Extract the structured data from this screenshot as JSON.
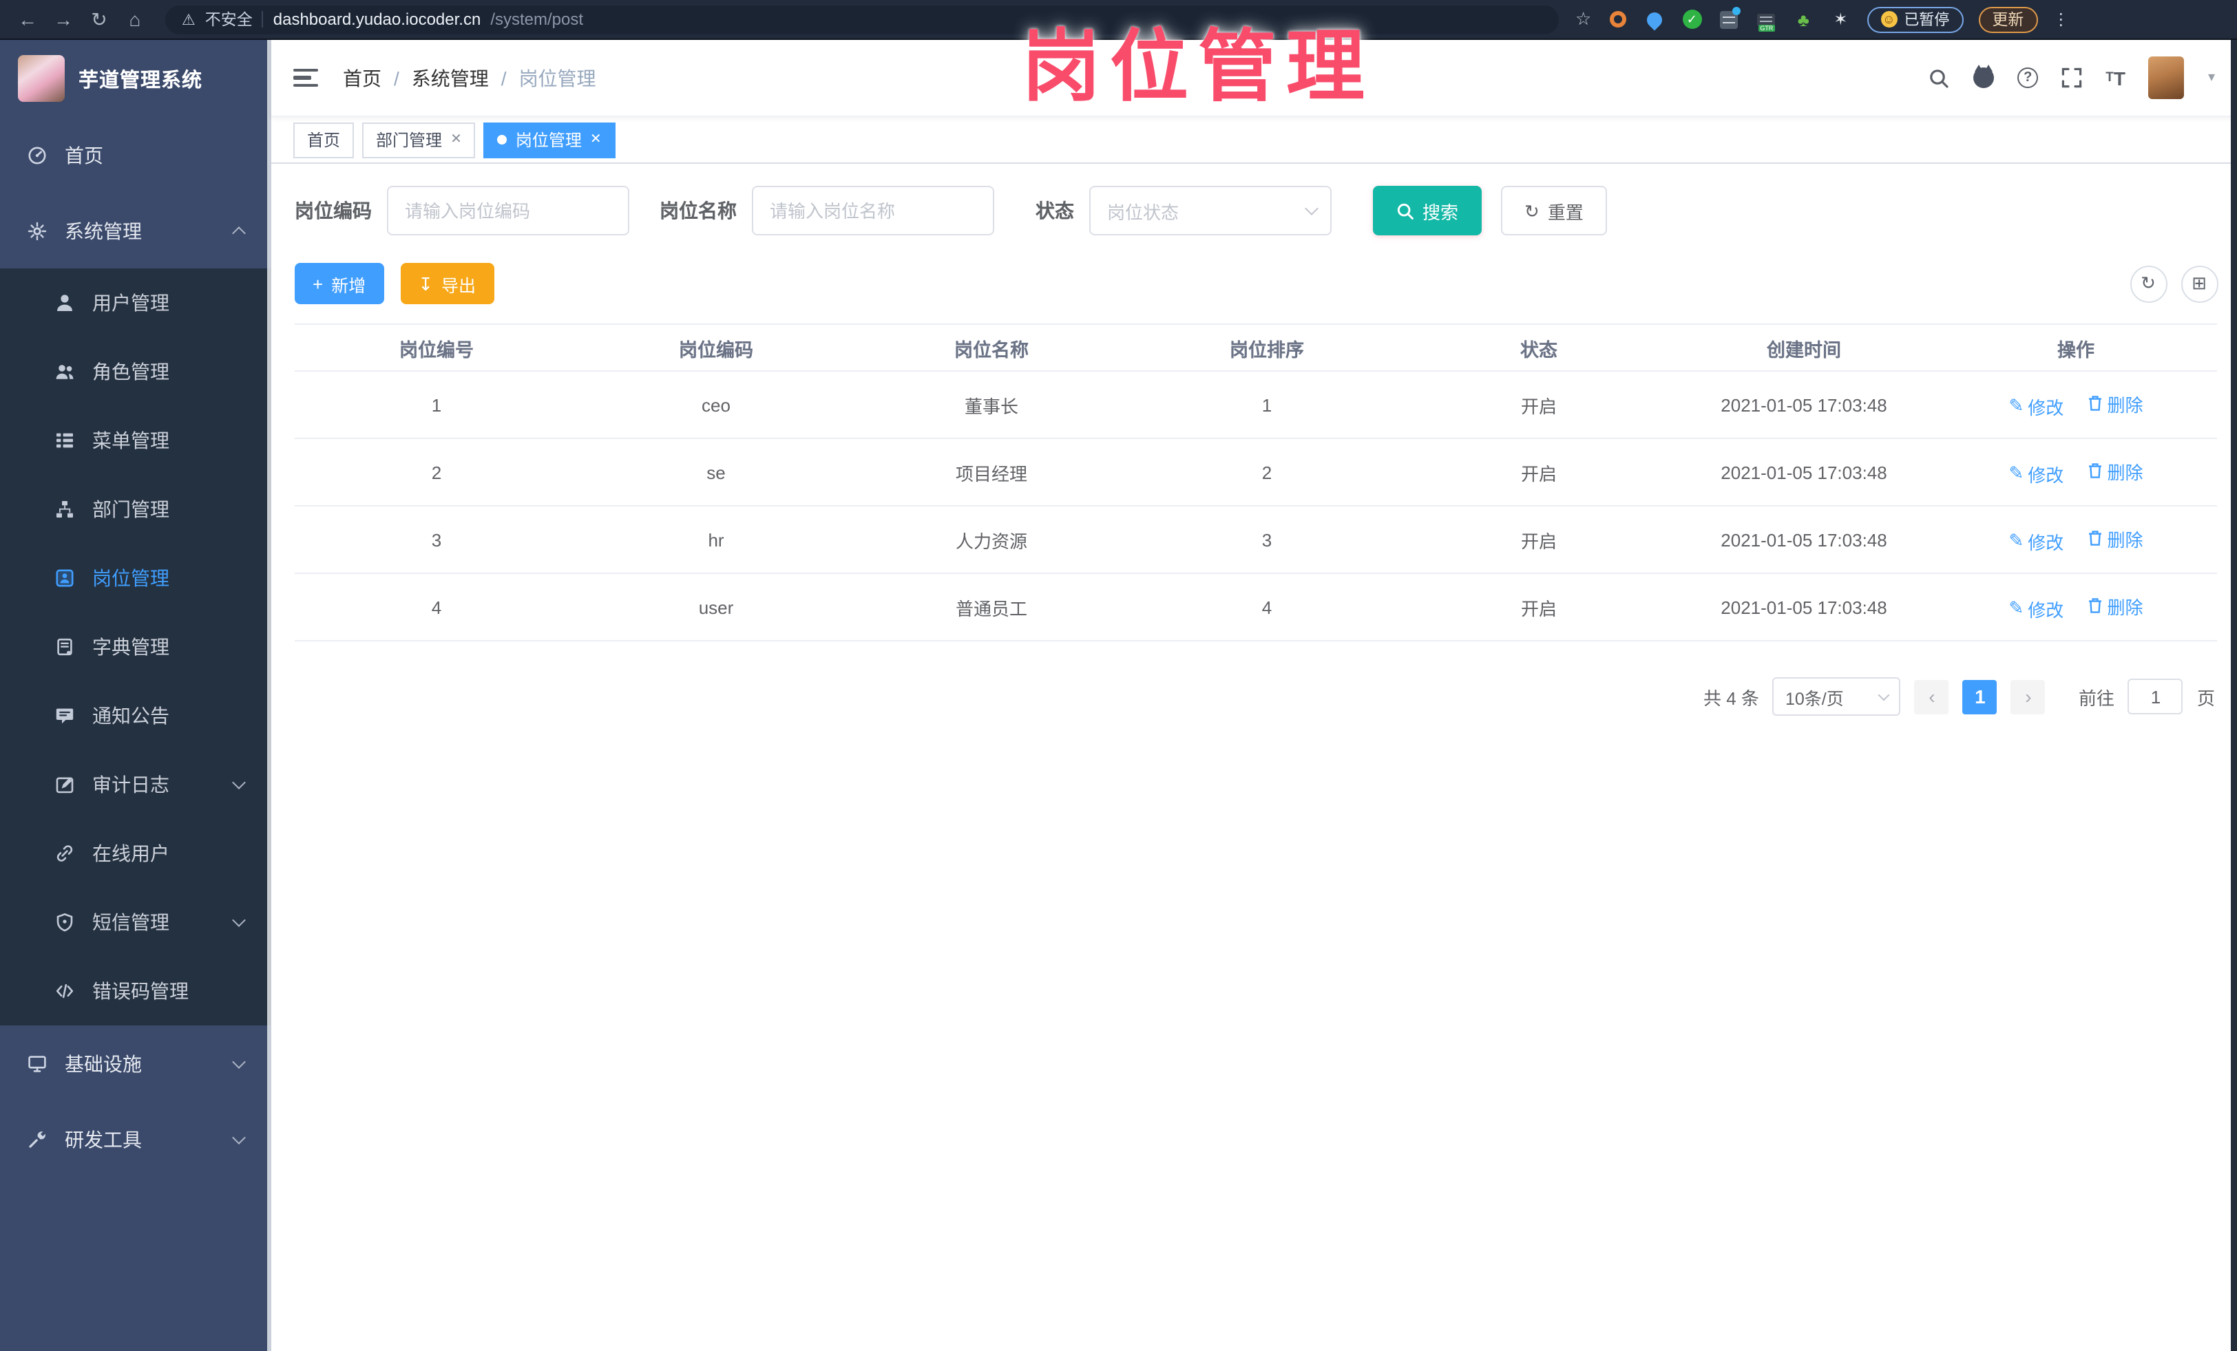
{
  "browser": {
    "secure_label": "不安全",
    "url_host": "dashboard.yudao.iocoder.cn",
    "url_path": "/system/post",
    "paused_badge": "已暂停",
    "update_button": "更新"
  },
  "watermark": {
    "text": "岗位管理",
    "color": "#f94c6b"
  },
  "sidebar": {
    "app_title": "芋道管理系统",
    "home": "首页",
    "system": "系统管理",
    "sub": [
      {
        "label": "用户管理"
      },
      {
        "label": "角色管理"
      },
      {
        "label": "菜单管理"
      },
      {
        "label": "部门管理"
      },
      {
        "label": "岗位管理",
        "active": true
      },
      {
        "label": "字典管理"
      },
      {
        "label": "通知公告"
      },
      {
        "label": "审计日志"
      },
      {
        "label": "在线用户"
      },
      {
        "label": "短信管理"
      },
      {
        "label": "错误码管理"
      }
    ],
    "infra": "基础设施",
    "devtools": "研发工具"
  },
  "header": {
    "breadcrumb": [
      "首页",
      "系统管理",
      "岗位管理"
    ]
  },
  "tabs": [
    {
      "label": "首页",
      "closable": false,
      "active": false
    },
    {
      "label": "部门管理",
      "closable": true,
      "active": false
    },
    {
      "label": "岗位管理",
      "closable": true,
      "active": true
    }
  ],
  "search": {
    "code_label": "岗位编码",
    "code_placeholder": "请输入岗位编码",
    "name_label": "岗位名称",
    "name_placeholder": "请输入岗位名称",
    "status_label": "状态",
    "status_placeholder": "岗位状态",
    "search_btn": "搜索",
    "reset_btn": "重置"
  },
  "toolbar": {
    "add_label": "新增",
    "export_label": "导出"
  },
  "table": {
    "columns": [
      "岗位编号",
      "岗位编码",
      "岗位名称",
      "岗位排序",
      "状态",
      "创建时间",
      "操作"
    ],
    "edit_label": "修改",
    "delete_label": "删除",
    "rows": [
      {
        "no": "1",
        "code": "ceo",
        "name": "董事长",
        "sort": "1",
        "status": "开启",
        "created": "2021-01-05 17:03:48"
      },
      {
        "no": "2",
        "code": "se",
        "name": "项目经理",
        "sort": "2",
        "status": "开启",
        "created": "2021-01-05 17:03:48"
      },
      {
        "no": "3",
        "code": "hr",
        "name": "人力资源",
        "sort": "3",
        "status": "开启",
        "created": "2021-01-05 17:03:48"
      },
      {
        "no": "4",
        "code": "user",
        "name": "普通员工",
        "sort": "4",
        "status": "开启",
        "created": "2021-01-05 17:03:48"
      }
    ]
  },
  "pagination": {
    "total": "共 4 条",
    "page_size": "10条/页",
    "current_page": "1",
    "goto_label": "前往",
    "goto_value": "1",
    "page_unit": "页"
  },
  "colors": {
    "accent": "#409eff",
    "success": "#14b8a6",
    "warning": "#f7a717"
  }
}
